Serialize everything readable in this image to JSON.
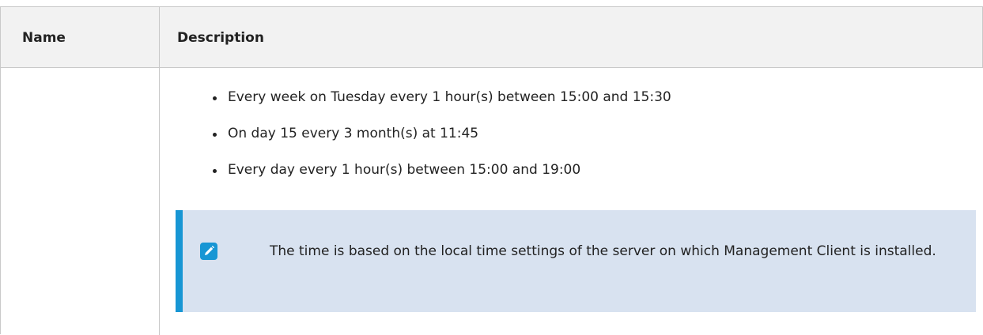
{
  "table": {
    "headers": {
      "name": "Name",
      "description": "Description"
    },
    "row": {
      "name": "",
      "bullets": [
        "Every week on Tuesday every 1 hour(s) between 15:00 and 15:30",
        "On day 15 every 3 month(s) at 11:45",
        "Every day every 1 hour(s) between 15:00 and 19:00"
      ],
      "note": {
        "icon": "pencil-icon",
        "text": "The time is based on the local time settings of the server on which Management Client is installed."
      }
    }
  },
  "colors": {
    "header_bg": "#f2f2f2",
    "border": "#c9c9c9",
    "note_bg": "#d8e2f0",
    "note_accent": "#1796d4"
  }
}
